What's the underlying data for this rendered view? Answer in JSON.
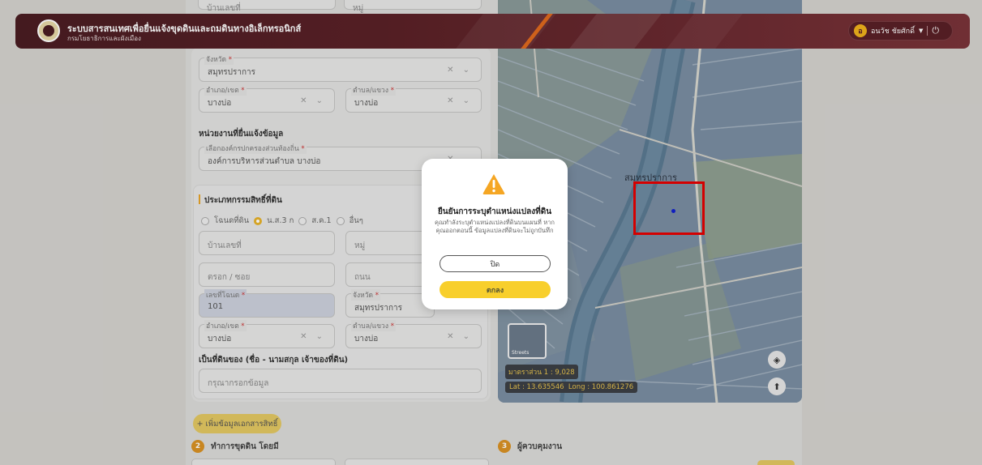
{
  "header": {
    "title": "ระบบสารสนเทศเพื่อยื่นแจ้งขุดดินและถมดินทางอิเล็กทรอนิกส์",
    "subtitle": "กรมโยธาธิการและผังเมือง",
    "user_initial": "อ",
    "user_name": "อนวัช ชัยศักดิ์"
  },
  "form": {
    "top_fields": {
      "house_no": "บ้านเลขที่",
      "moo": "หมู่"
    },
    "location1": {
      "province_label": "จังหวัด",
      "province_value": "สมุทรปราการ",
      "district_label": "อำเภอ/เขต",
      "district_value": "บางบ่อ",
      "subdistrict_label": "ตำบล/แขวง",
      "subdistrict_value": "บางบ่อ"
    },
    "agency": {
      "section_title": "หน่วยงานที่ยื่นแจ้งข้อมูล",
      "label": "เลือกองค์กรปกครองส่วนท้องถิ่น",
      "value": "องค์การบริหารส่วนตำบล บางบ่อ"
    },
    "ownership": {
      "section_title": "ประเภทกรรมสิทธิ์ที่ดิน",
      "options": [
        "โฉนดที่ดิน",
        "น.ส.3 ก",
        "ส.ค.1",
        "อื่นๆ"
      ],
      "selected": "น.ส.3 ก",
      "house_no_placeholder": "บ้านเลขที่",
      "moo_placeholder": "หมู่",
      "soi_placeholder": "ตรอก / ซอย",
      "road_placeholder": "ถนน",
      "deed_label": "เลขที่โฉนด",
      "deed_value": "101",
      "province_label": "จังหวัด",
      "province_value": "สมุทรปราการ",
      "district_label": "อำเภอ/เขต",
      "district_value": "บางบ่อ",
      "subdistrict_label": "ตำบล/แขวง",
      "subdistrict_value": "บางบ่อ",
      "owner_title": "เป็นที่ดินของ (ชื่อ - นามสกุล เจ้าของที่ดิน)",
      "owner_placeholder": "กรุณากรอกข้อมูล"
    },
    "add_doc_button": "+ เพิ่มข้อมูลเอกสารสิทธิ์",
    "step2": {
      "num": "2",
      "label": "ทำการขุดดิน โดยมี"
    },
    "step3": {
      "num": "3",
      "label": "ผู้ควบคุมงาน"
    }
  },
  "map": {
    "place_label": "สมุทรปราการ",
    "scale_text": "มาตราส่วน 1 : 9,028",
    "lat_text": "Lat : 13.635546",
    "lng_text": "Long : 100.861276",
    "thumb_label": "Streets"
  },
  "modal": {
    "title": "ยืนยันการระบุตำแหน่งแปลงที่ดิน",
    "body": "คุณทำลังระบุตำแหน่งแปลงที่ดินบนแผนที่ หากคุณออกตอนนี้ ข้อมูลแปลงที่ดินจะไม่ถูกบันทึก",
    "close_label": "ปิด",
    "ok_label": "ตกลง"
  }
}
